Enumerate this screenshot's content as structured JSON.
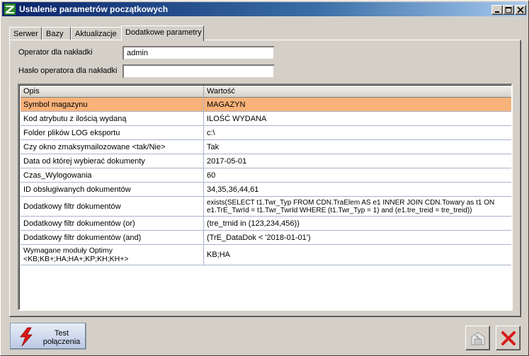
{
  "window": {
    "title": "Ustalenie parametrów początkowych"
  },
  "tabs": [
    {
      "label": "Serwer"
    },
    {
      "label": "Bazy"
    },
    {
      "label": "Aktualizacje"
    },
    {
      "label": "Dodatkowe parametry"
    }
  ],
  "active_tab": "Dodatkowe parametry",
  "form": {
    "operator_label": "Operator dla nakładki",
    "operator_value": "admin",
    "password_label": "Hasło operatora dla nakładki",
    "password_value": ""
  },
  "table": {
    "columns": [
      "Opis",
      "Wartość"
    ],
    "selected_row": "Symbol magazynu",
    "selected_color": "#f8b27a",
    "rows": [
      {
        "opis": "Symbol magazynu",
        "wartosc": "MAGAZYN"
      },
      {
        "opis": "Kod atrybutu z ilością wydaną",
        "wartosc": "ILOŚĆ WYDANA"
      },
      {
        "opis": "Folder plików LOG eksportu",
        "wartosc": "c:\\"
      },
      {
        "opis": "Czy okno zmaksymailozowane <tak/Nie>",
        "wartosc": "Tak"
      },
      {
        "opis": "Data od której wybierać dokumenty",
        "wartosc": "2017-05-01"
      },
      {
        "opis": "Czas_Wylogowania",
        "wartosc": "60"
      },
      {
        "opis": "ID obsługiwanych dokumentów",
        "wartosc": "34,35,36,44,61"
      },
      {
        "opis": "Dodatkowy filtr dokumentów",
        "wartosc": "exists(SELECT      t1.Twr_Typ FROM CDN.TraElem AS e1 INNER JOIN CDN.Towary as t1 ON e1.TrE_TwrId = t1.Twr_TwrId WHERE (t1.Twr_Typ = 1) and (e1.tre_treid  = tre_treid))"
      },
      {
        "opis": "Dodatkowy filtr dokumentów (or)",
        "wartosc": "(tre_trnid in (123,234,456))"
      },
      {
        "opis": "Dodatkowy filtr dokumentów (and)",
        "wartosc": "(TrE_DataDok < '2018-01-01')"
      },
      {
        "opis": "Wymagane moduły Optimy <KB;KB+;HA;HA+;KP;KH;KH+>",
        "wartosc": "KB;HA"
      }
    ]
  },
  "buttons": {
    "test_connection": "Test połączenia",
    "save_icon": "save-disabled-icon",
    "close_icon": "red-x-icon"
  },
  "colors": {
    "titlebar_start": "#0a246a",
    "titlebar_end": "#a6caf0",
    "close_red": "#d81c1c",
    "window_bg": "#d4d0c8"
  }
}
